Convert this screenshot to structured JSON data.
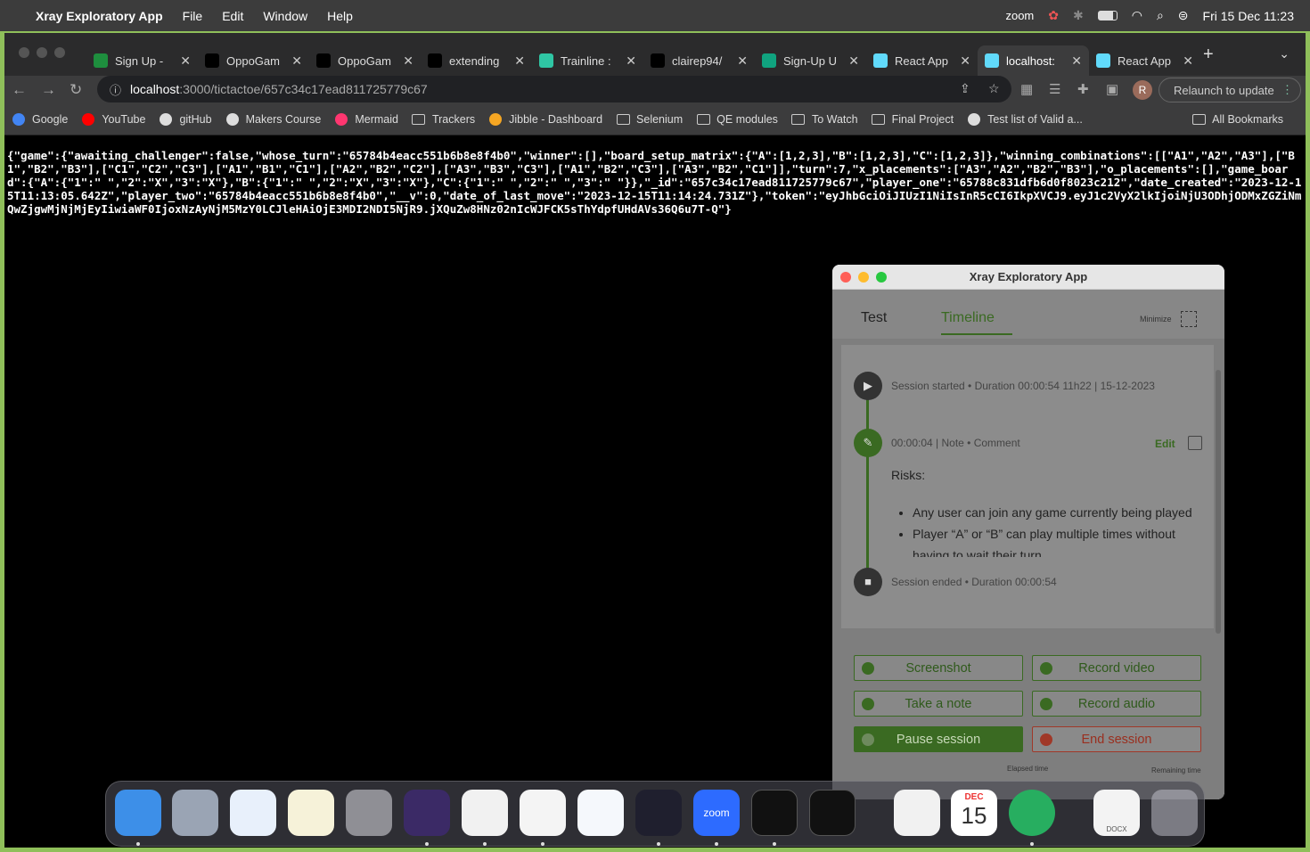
{
  "menubar": {
    "app": "Xray Exploratory App",
    "menus": [
      "File",
      "Edit",
      "Window",
      "Help"
    ],
    "zoom": "zoom",
    "datetime": "Fri 15 Dec  11:23"
  },
  "tabs": [
    {
      "title": "Sign Up -",
      "color": "#1e8e3e",
      "icon": "sheets-icon"
    },
    {
      "title": "OppoGam",
      "color": "#000",
      "icon": "github-icon"
    },
    {
      "title": "OppoGam",
      "color": "#000",
      "icon": "github-icon"
    },
    {
      "title": "extending",
      "color": "#000",
      "icon": "github-icon"
    },
    {
      "title": "Trainline :",
      "color": "#2fc6a4",
      "icon": "trainline-icon"
    },
    {
      "title": "clairep94/",
      "color": "#000",
      "icon": "github-icon"
    },
    {
      "title": "Sign-Up U",
      "color": "#10a37f",
      "icon": "chatgpt-icon"
    },
    {
      "title": "React App",
      "color": "#61dafb",
      "icon": "react-icon"
    },
    {
      "title": "localhost:",
      "color": "#61dafb",
      "icon": "react-icon",
      "active": true
    },
    {
      "title": "React App",
      "color": "#61dafb",
      "icon": "react-icon"
    }
  ],
  "url": {
    "host": "localhost",
    "path": ":3000/tictactoe/657c34c17ead811725779c67"
  },
  "relaunch": "Relaunch to update",
  "avatar": "R",
  "bookmarks": [
    {
      "label": "Google",
      "icon": "google-icon"
    },
    {
      "label": "YouTube",
      "icon": "youtube-icon"
    },
    {
      "label": "gitHub",
      "icon": "github-icon"
    },
    {
      "label": "Makers Course",
      "icon": "github-icon"
    },
    {
      "label": "Mermaid",
      "icon": "mermaid-icon"
    },
    {
      "label": "Trackers",
      "icon": "folder-icon"
    },
    {
      "label": "Jibble - Dashboard",
      "icon": "jibble-icon"
    },
    {
      "label": "Selenium",
      "icon": "folder-icon"
    },
    {
      "label": "QE modules",
      "icon": "folder-icon"
    },
    {
      "label": "To Watch",
      "icon": "folder-icon"
    },
    {
      "label": "Final Project",
      "icon": "folder-icon"
    },
    {
      "label": "Test list of Valid a...",
      "icon": "github-icon"
    }
  ],
  "all_bookmarks": "All Bookmarks",
  "json_body": "{\"game\":{\"awaiting_challenger\":false,\"whose_turn\":\"65784b4eacc551b6b8e8f4b0\",\"winner\":[],\"board_setup_matrix\":{\"A\":[1,2,3],\"B\":[1,2,3],\"C\":[1,2,3]},\"winning_combinations\":[[\"A1\",\"A2\",\"A3\"],[\"B1\",\"B2\",\"B3\"],[\"C1\",\"C2\",\"C3\"],[\"A1\",\"B1\",\"C1\"],[\"A2\",\"B2\",\"C2\"],[\"A3\",\"B3\",\"C3\"],[\"A1\",\"B2\",\"C3\"],[\"A3\",\"B2\",\"C1\"]],\"turn\":7,\"x_placements\":[\"A3\",\"A2\",\"B2\",\"B3\"],\"o_placements\":[],\"game_board\":{\"A\":{\"1\":\" \",\"2\":\"X\",\"3\":\"X\"},\"B\":{\"1\":\" \",\"2\":\"X\",\"3\":\"X\"},\"C\":{\"1\":\" \",\"2\":\" \",\"3\":\" \"}},\"_id\":\"657c34c17ead811725779c67\",\"player_one\":\"65788c831dfb6d0f8023c212\",\"date_created\":\"2023-12-15T11:13:05.642Z\",\"player_two\":\"65784b4eacc551b6b8e8f4b0\",\"__v\":0,\"date_of_last_move\":\"2023-12-15T11:14:24.731Z\"},\"token\":\"eyJhbGciOiJIUzI1NiIsInR5cCI6IkpXVCJ9.eyJ1c2VyX2lkIjoiNjU3ODhjODMxZGZiNmQwZjgwMjNjMjEyIiwiaWF0IjoxNzAyNjM5MzY0LCJleHAiOjE3MDI2NDI5NjR9.jXQuZw8HNz02nIcWJFCK5sThYdpfUHdAVs36Q6u7T-Q\"}",
  "xray": {
    "title": "Xray Exploratory App",
    "tab_test": "Test",
    "tab_timeline": "Timeline",
    "minimize": "Minimize",
    "session_started": "Session started • Duration 00:00:54 11h22 | 15-12-2023",
    "note_meta": "00:00:04 | Note • Comment",
    "edit": "Edit",
    "note_heading": "Risks:",
    "note_items": [
      "Any user can join any game currently being played",
      "Player “A” or “B” can play multiple times without having to wait their turn"
    ],
    "session_ended": "Session ended • Duration 00:00:54",
    "buttons": {
      "screenshot": "Screenshot",
      "record_video": "Record video",
      "take_note": "Take a note",
      "record_audio": "Record audio",
      "pause": "Pause session",
      "end": "End session"
    },
    "elapsed": "Elapsed time",
    "remaining": "Remaining time"
  },
  "dock": {
    "calendar_month": "DEC",
    "calendar_day": "15",
    "zoom": "zoom",
    "docx": "DOCX"
  }
}
